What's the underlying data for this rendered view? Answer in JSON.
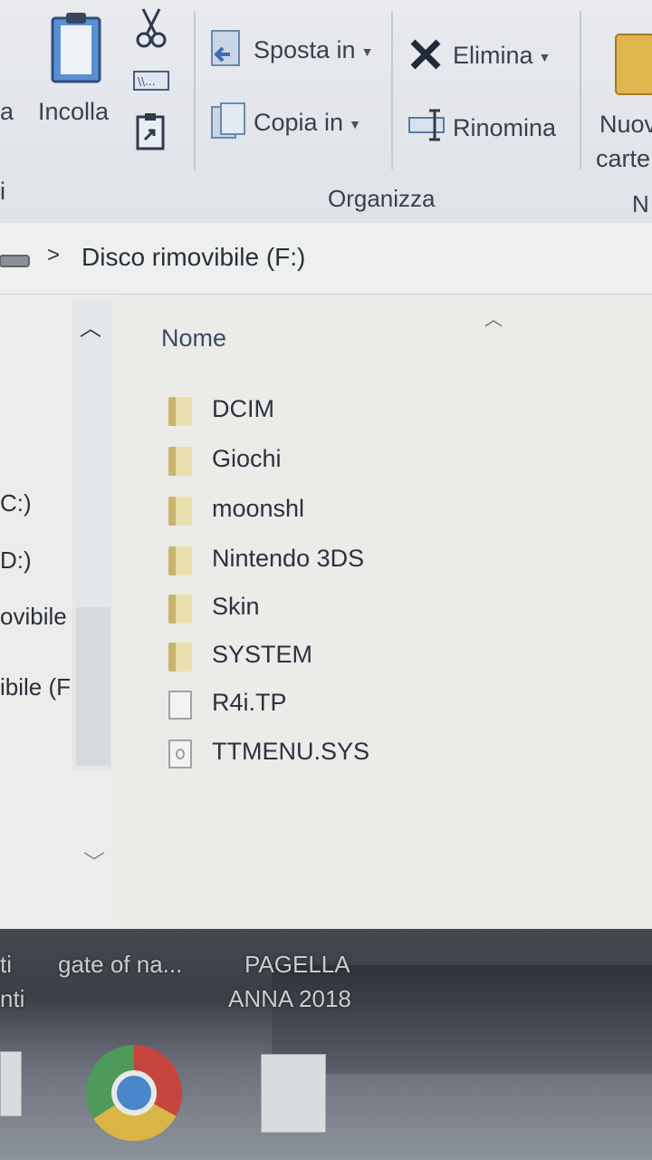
{
  "ribbon": {
    "left_cut_a": "a",
    "left_cut_i": "i",
    "paste_label": "Incolla",
    "move_label": "Sposta in",
    "copy_label": "Copia in",
    "delete_label": "Elimina",
    "rename_label": "Rinomina",
    "new_folder_line1": "Nuov",
    "new_folder_line2": "carte",
    "group_organize": "Organizza",
    "group_new_cut": "N"
  },
  "address": {
    "path": "Disco rimovibile (F:)"
  },
  "nav": {
    "items": [
      "C:)",
      "D:)",
      "ovibile",
      "ibile (F"
    ]
  },
  "columns": {
    "name": "Nome"
  },
  "files": [
    {
      "name": "DCIM",
      "type": "folder"
    },
    {
      "name": "Giochi",
      "type": "folder"
    },
    {
      "name": "moonshl",
      "type": "folder"
    },
    {
      "name": "Nintendo 3DS",
      "type": "folder"
    },
    {
      "name": "Skin",
      "type": "folder"
    },
    {
      "name": "SYSTEM",
      "type": "folder"
    },
    {
      "name": "R4i.TP",
      "type": "file"
    },
    {
      "name": "TTMENU.SYS",
      "type": "system-file"
    }
  ],
  "desktop": {
    "icon1_label": "gate of na...",
    "icon2_line1": "PAGELLA",
    "icon2_line2": "ANNA 2018",
    "left_cut1": "ti",
    "left_cut2": "nti"
  }
}
